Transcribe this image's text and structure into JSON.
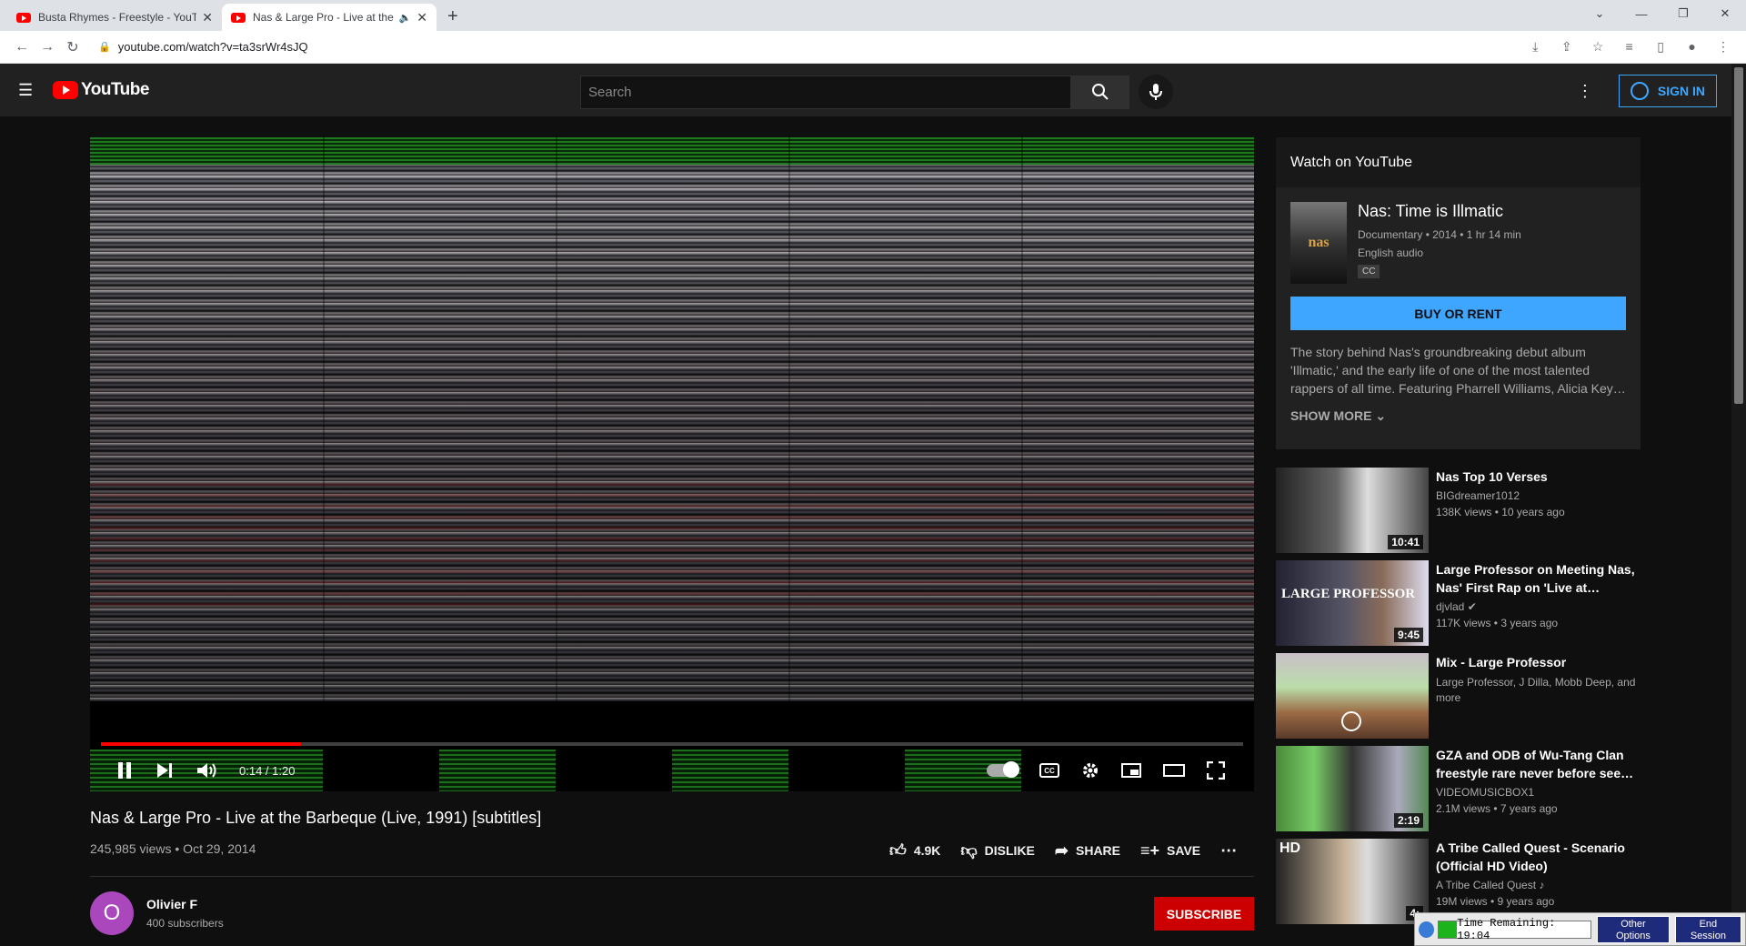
{
  "browser": {
    "tabs": [
      {
        "title": "Busta Rhymes - Freestyle - YouTu",
        "active": false
      },
      {
        "title": "Nas & Large Pro - Live at the",
        "active": true
      }
    ],
    "url": "youtube.com/watch?v=ta3srWr4sJQ"
  },
  "youtube": {
    "logo_text": "YouTube",
    "search_placeholder": "Search",
    "sign_in": "SIGN IN"
  },
  "player": {
    "time": "0:14 / 1:20",
    "progress": 0.175
  },
  "video": {
    "title": "Nas & Large Pro - Live at the Barbeque (Live, 1991) [subtitles]",
    "meta": "245,985 views • Oct 29, 2014",
    "likes": "4.9K",
    "dislike": "DISLIKE",
    "share": "SHARE",
    "save": "SAVE",
    "channel_initial": "O",
    "channel_name": "Olivier F",
    "subscribers": "400 subscribers",
    "subscribe": "SUBSCRIBE"
  },
  "watch_panel": {
    "heading": "Watch on YouTube",
    "poster_text": "nas",
    "movie_title": "Nas: Time is Illmatic",
    "movie_meta": "Documentary • 2014 • 1 hr 14 min",
    "audio": "English audio",
    "cc": "CC",
    "buy": "BUY OR RENT",
    "description": "The story behind Nas's groundbreaking debut album 'Illmatic,' and the early life of one of the most talented rappers of all time. Featuring Pharrell Williams, Alicia Key…",
    "show_more": "SHOW MORE"
  },
  "recommendations": [
    {
      "title": "Nas Top 10 Verses",
      "channel": "BIGdreamer1012",
      "views": "138K views • 10 years ago",
      "duration": "10:41"
    },
    {
      "title": "Large Professor on Meeting Nas, Nas' First Rap on 'Live at…",
      "channel": "djvlad",
      "views": "117K views • 3 years ago",
      "duration": "9:45",
      "overlay": "LARGE PROFESSOR"
    },
    {
      "title": "Mix - Large Professor",
      "channel": "Large Professor, J Dilla, Mobb Deep, and more",
      "views": "",
      "duration": ""
    },
    {
      "title": "GZA and ODB of Wu-Tang Clan freestyle rare never before see…",
      "channel": "VIDEOMUSICBOX1",
      "views": "2.1M views • 7 years ago",
      "duration": "2:19"
    },
    {
      "title": "A Tribe Called Quest - Scenario (Official HD Video)",
      "channel": "A Tribe Called Quest",
      "views": "19M views • 9 years ago",
      "duration": "4:",
      "overlay": "HD"
    }
  ],
  "timer": {
    "label": "Time Remaining: 19:04",
    "fill": 0.12,
    "other_options": "Other Options",
    "end_session": "End Session"
  },
  "colors": {
    "accent": "#3ea6ff",
    "red": "#ff0000",
    "subscribe": "#cc0000"
  }
}
